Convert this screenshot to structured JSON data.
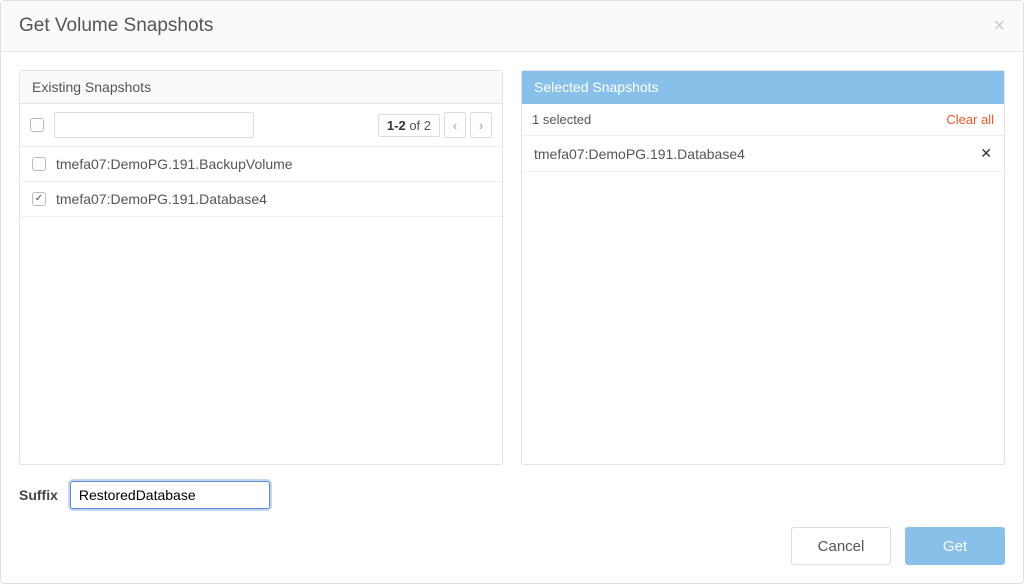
{
  "dialog": {
    "title": "Get Volume Snapshots",
    "close_glyph": "×"
  },
  "existing": {
    "header": "Existing Snapshots",
    "search_value": "",
    "pager": {
      "range_bold": "1-2",
      "range_rest": " of 2",
      "prev_glyph": "‹",
      "next_glyph": "›"
    },
    "rows": [
      {
        "label": "tmefa07:DemoPG.191.BackupVolume",
        "checked": false
      },
      {
        "label": "tmefa07:DemoPG.191.Database4",
        "checked": true
      }
    ]
  },
  "selected": {
    "header": "Selected Snapshots",
    "count_text": "1 selected",
    "clear_all": "Clear all",
    "rows": [
      {
        "label": "tmefa07:DemoPG.191.Database4"
      }
    ],
    "remove_glyph": "✕"
  },
  "suffix": {
    "label": "Suffix",
    "value": "RestoredDatabase"
  },
  "buttons": {
    "cancel": "Cancel",
    "get": "Get"
  }
}
